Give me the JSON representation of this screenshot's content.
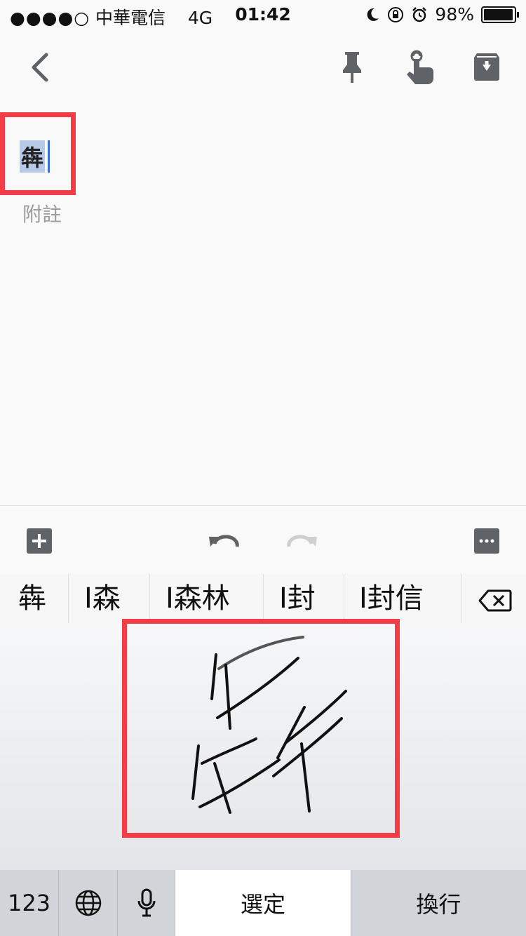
{
  "status_bar": {
    "signal_dots": "●●●●○",
    "carrier": "中華電信",
    "network": "4G",
    "time": "01:42",
    "battery_percent": "98%",
    "battery_level": 0.98,
    "icons": [
      "moon-icon",
      "rotation-lock-icon",
      "alarm-icon"
    ]
  },
  "toolbar": {
    "icons": [
      "back-icon",
      "pin-icon",
      "reminder-icon",
      "archive-icon"
    ]
  },
  "note": {
    "title": "犇",
    "body_placeholder": "附註"
  },
  "editor_bar": {
    "icons": [
      "add-box-icon",
      "undo-icon",
      "redo-icon",
      "more-icon"
    ]
  },
  "candidates": [
    "犇",
    "I森",
    "I森林",
    "I封",
    "I封信"
  ],
  "keyboard": {
    "numbers_key": "123",
    "select_key": "選定",
    "return_key": "換行",
    "icons": [
      "globe-icon",
      "microphone-icon",
      "backspace-icon"
    ]
  },
  "colors": {
    "highlight_border": "#f43c46",
    "selection": "#b6c9e7",
    "caret": "#3b6fe0"
  }
}
